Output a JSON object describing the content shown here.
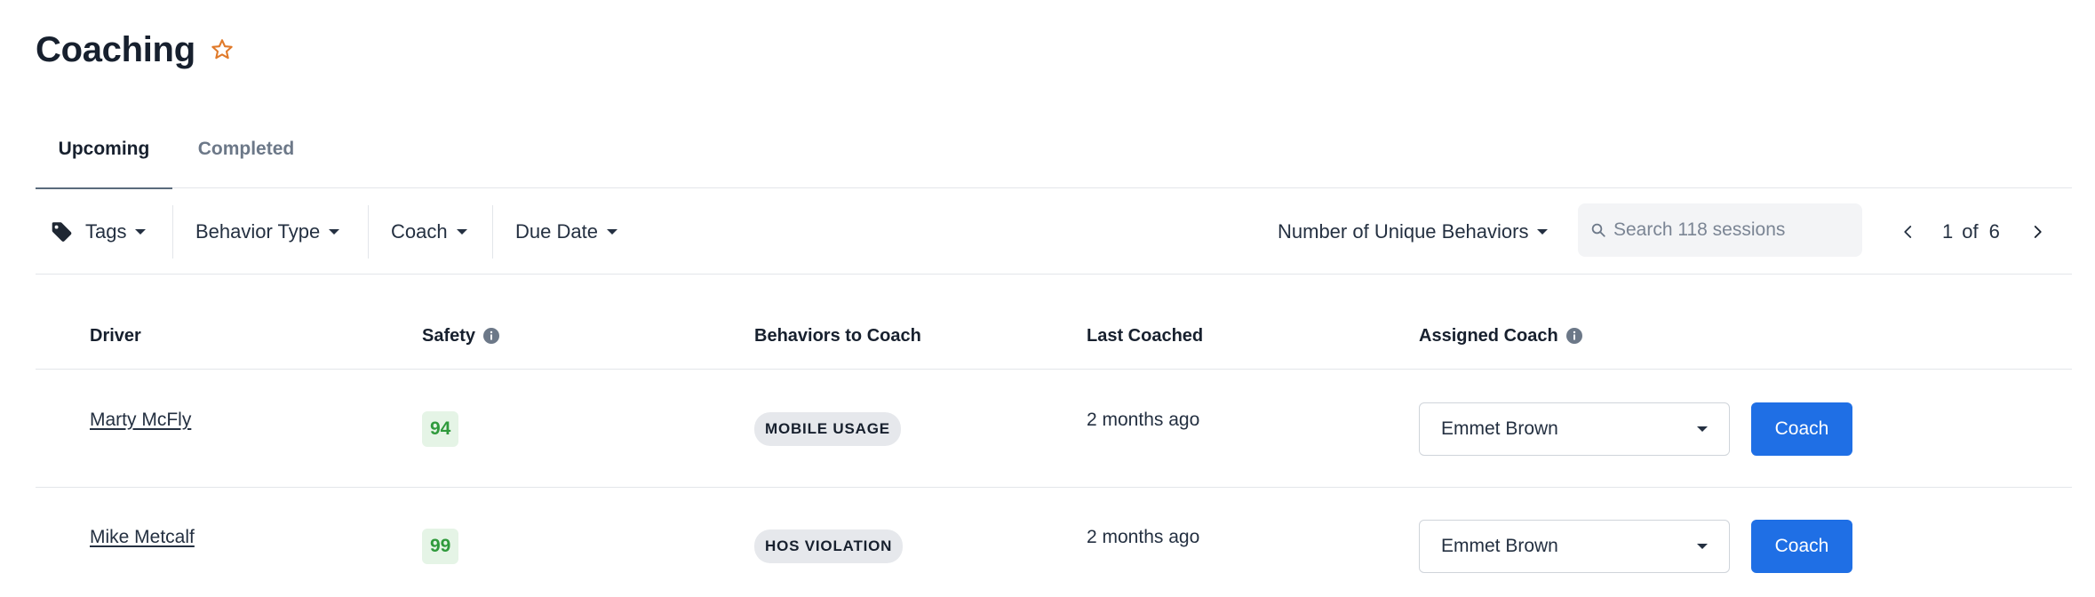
{
  "page": {
    "title": "Coaching",
    "favorite_icon": "star-outline-icon",
    "accent_color": "#e07a2a"
  },
  "tabs": [
    {
      "label": "Upcoming",
      "active": true
    },
    {
      "label": "Completed",
      "active": false
    }
  ],
  "filters": {
    "tags": "Tags",
    "behavior_type": "Behavior Type",
    "coach": "Coach",
    "due_date": "Due Date",
    "sort": "Number of Unique Behaviors"
  },
  "search": {
    "placeholder": "Search 118 sessions",
    "value": ""
  },
  "pagination": {
    "current": "1",
    "of": "of",
    "total": "6"
  },
  "table": {
    "columns": {
      "driver": "Driver",
      "safety": "Safety",
      "behaviors": "Behaviors to Coach",
      "last_coached": "Last Coached",
      "assigned_coach": "Assigned Coach"
    },
    "rows": [
      {
        "driver": "Marty McFly",
        "safety": "94",
        "behavior": "MOBILE USAGE",
        "last_coached": "2 months ago",
        "coach": "Emmet Brown",
        "action": "Coach"
      },
      {
        "driver": "Mike Metcalf",
        "safety": "99",
        "behavior": "HOS VIOLATION",
        "last_coached": "2 months ago",
        "coach": "Emmet Brown",
        "action": "Coach"
      }
    ]
  },
  "colors": {
    "primary_button": "#1f6fe5",
    "score_good_bg": "#e5f4e6",
    "score_good_text": "#2f9a3c"
  }
}
